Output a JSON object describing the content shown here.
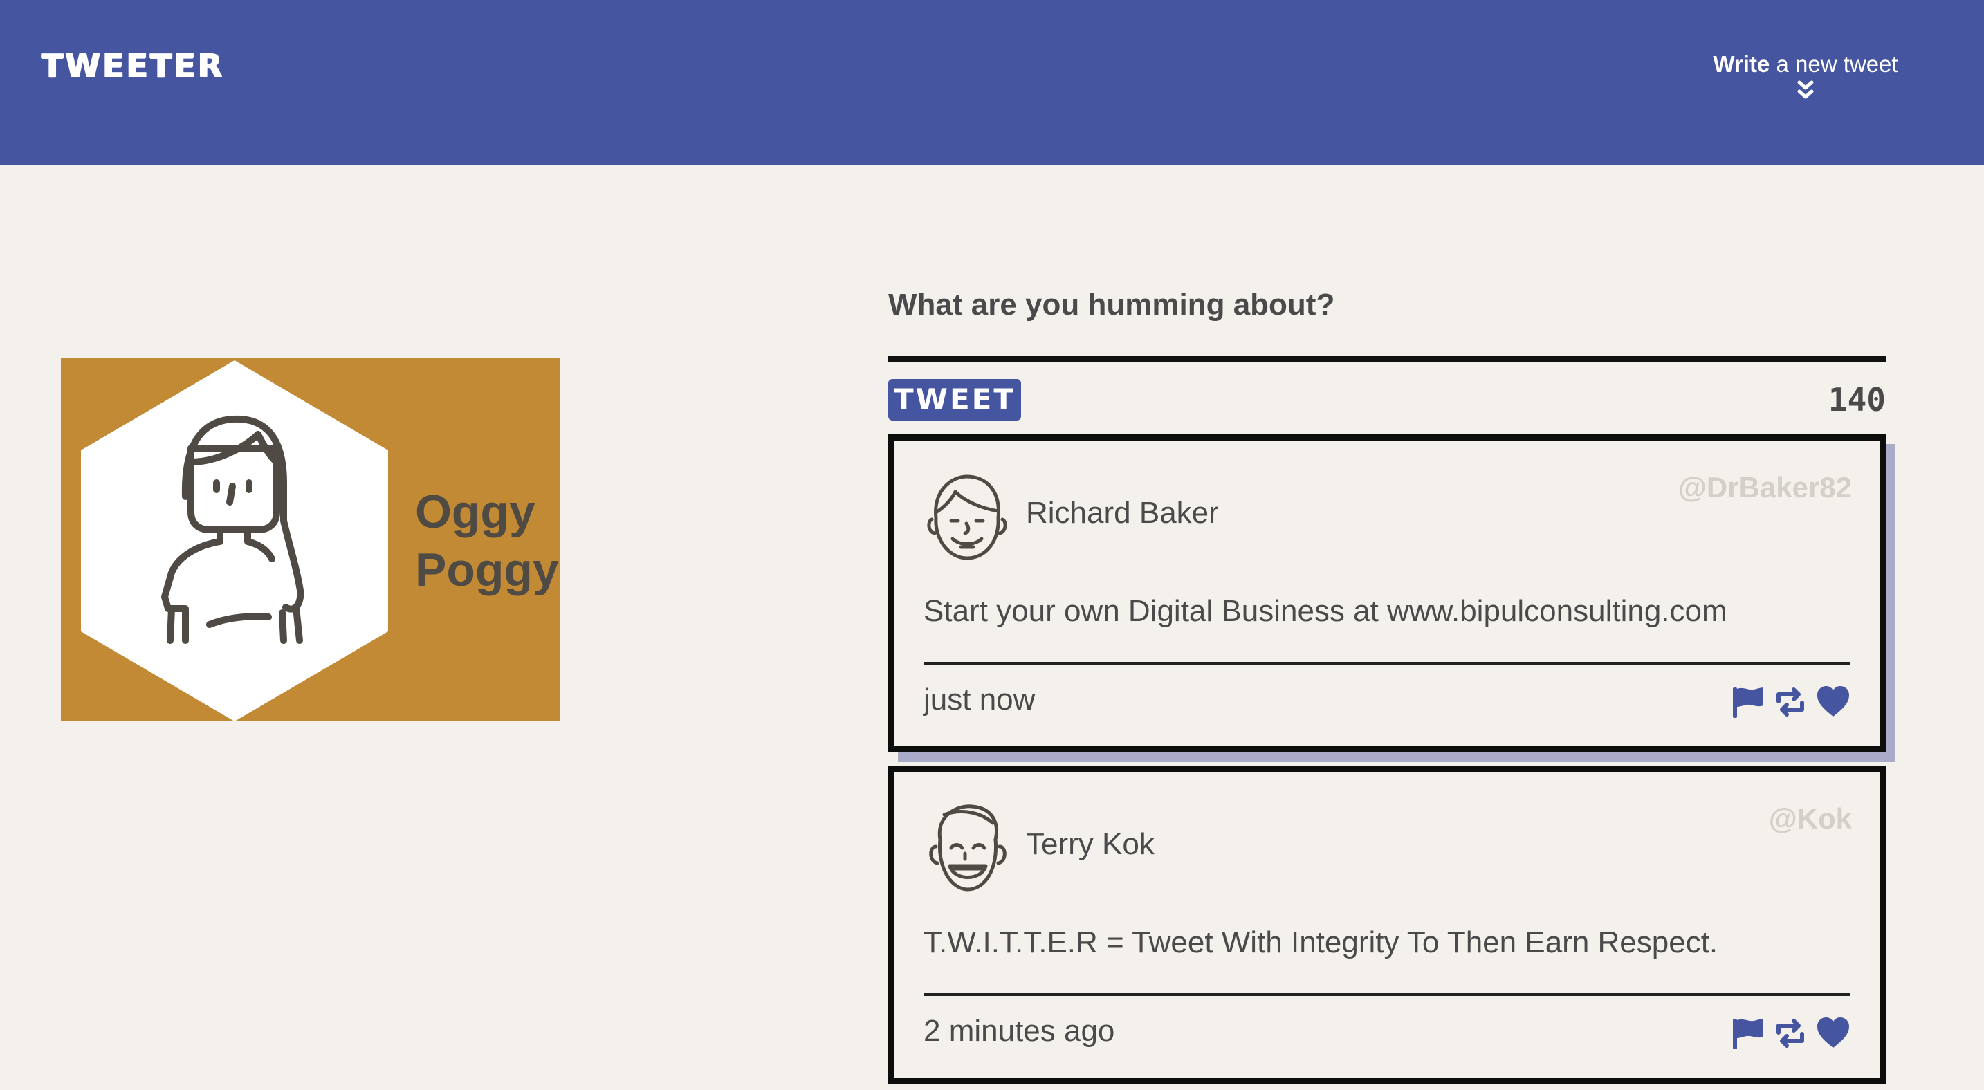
{
  "nav": {
    "brand": "TWEETER",
    "compose_toggle": {
      "bold": "Write",
      "rest": " a new tweet",
      "icon": "double-chevron-down-icon"
    }
  },
  "profile": {
    "first_name": "Oggy",
    "last_name": "Poggy",
    "avatar_icon": "woman-avatar-icon",
    "background_color": "#c28a34"
  },
  "compose": {
    "prompt": "What are you humming about?",
    "button_label": "TWEET",
    "char_count": "140"
  },
  "tweets": [
    {
      "author": "Richard Baker",
      "handle": "@DrBaker82",
      "avatar_icon": "smiling-man-avatar-icon",
      "content": "Start your own Digital Business at www.bipulconsulting.com",
      "timestamp": "just now",
      "actions": [
        "flag-icon",
        "retweet-icon",
        "heart-icon"
      ]
    },
    {
      "author": "Terry Kok",
      "handle": "@Kok",
      "avatar_icon": "laughing-man-avatar-icon",
      "content": "T.W.I.T.T.E.R = Tweet With Integrity To Then Earn Respect.",
      "timestamp": "2 minutes ago",
      "actions": [
        "flag-icon",
        "retweet-icon",
        "heart-icon"
      ]
    }
  ],
  "colors": {
    "accent": "#4555a0",
    "background": "#f4f1ec",
    "text": "#4a4a4a",
    "handle": "#d3d0ca"
  }
}
